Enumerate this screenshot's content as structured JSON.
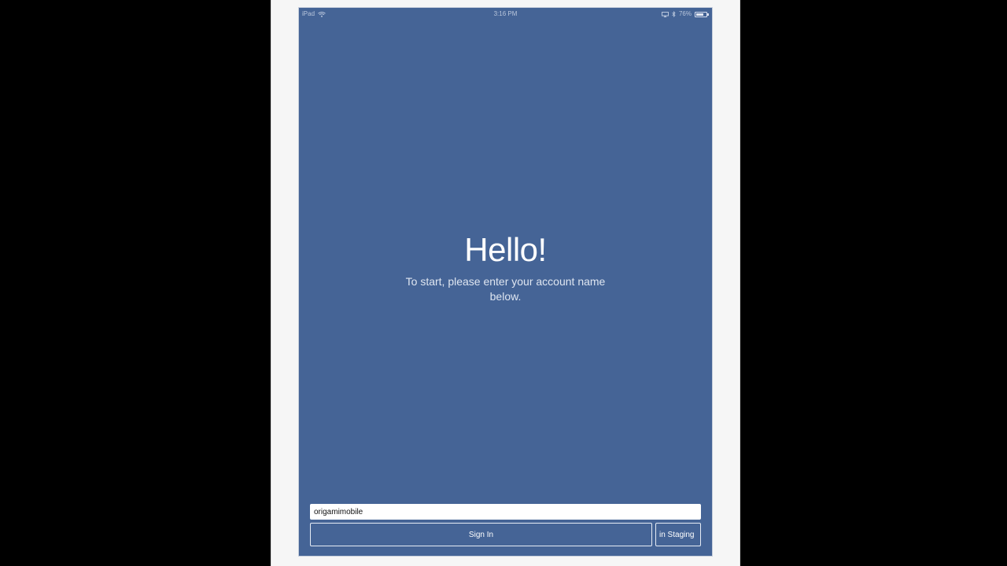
{
  "status_bar": {
    "device": "iPad",
    "time": "3:16 PM",
    "battery": "76%",
    "battery_level": 0.76,
    "icons": [
      "wifi-icon",
      "airplay-icon",
      "bluetooth-icon",
      "battery-icon"
    ]
  },
  "hero": {
    "title": "Hello!",
    "subtitle": "To start, please enter your account name below."
  },
  "form": {
    "account_value": "origamimobile",
    "sign_in_label": "Sign In",
    "staging_label": "in Staging"
  },
  "colors": {
    "background_outer": "#000000",
    "device_frame": "#f6f6f6",
    "screen_background": "#456496",
    "button_border": "#e6ecf5",
    "text": "#ffffff"
  }
}
